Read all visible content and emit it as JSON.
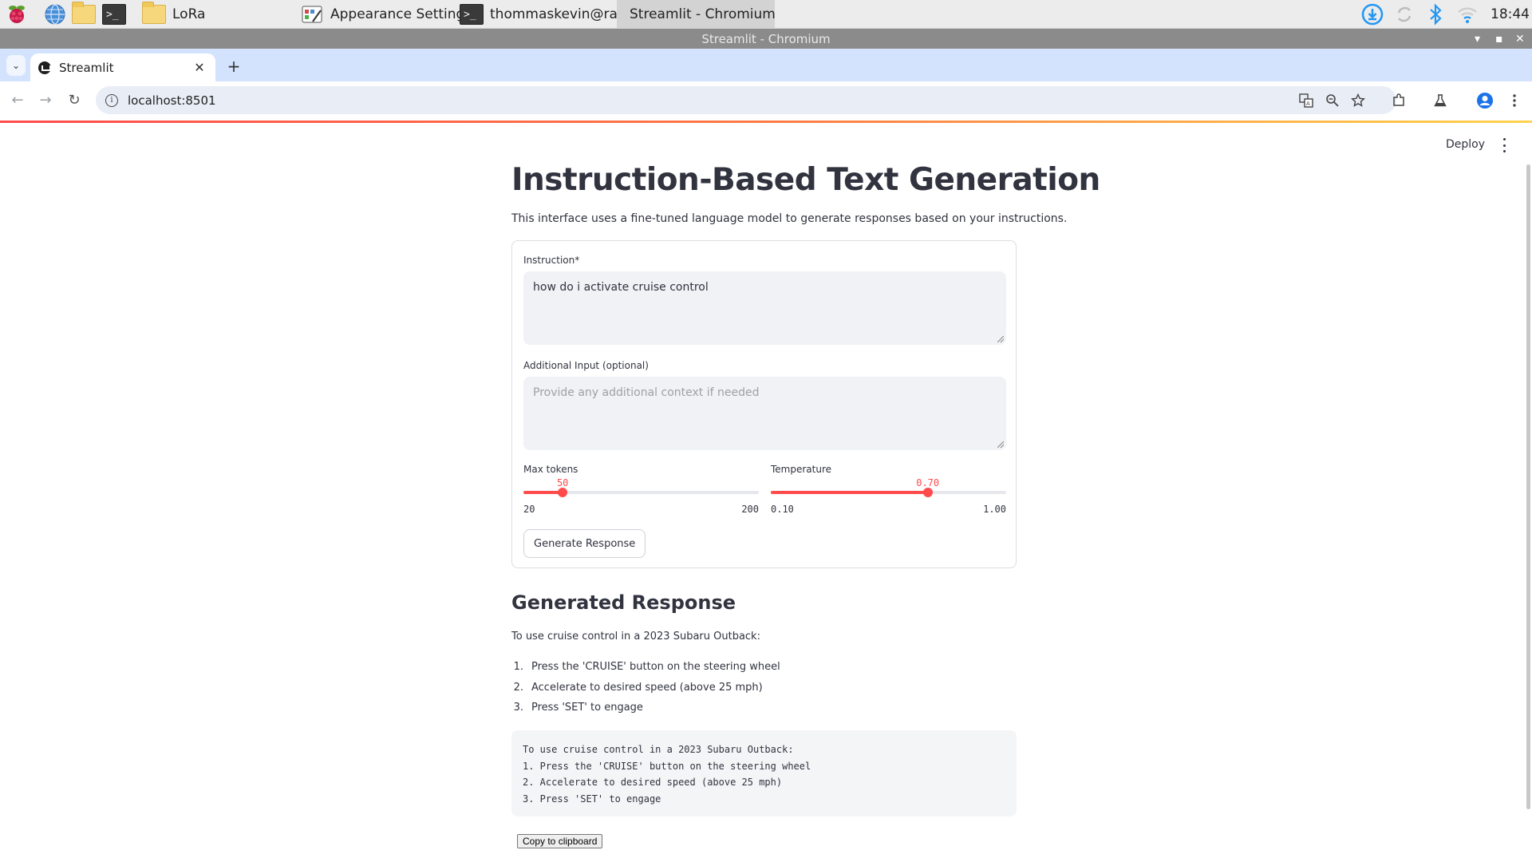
{
  "taskbar": {
    "tasks": [
      {
        "label": "LoRa",
        "icon": "folder-icon"
      },
      {
        "label": "Appearance Settings",
        "icon": "appearance-settings-icon"
      },
      {
        "label": "thommaskevin@ras..",
        "icon": "terminal-icon"
      },
      {
        "label": "Streamlit - Chromium",
        "icon": "chromium-icon"
      }
    ],
    "terminal_glyph": ">_",
    "clock": "18:44"
  },
  "window": {
    "title": "Streamlit - Chromium",
    "controls": {
      "minimize": "▾",
      "maximize": "▪",
      "close": "✕"
    }
  },
  "browser": {
    "tab_title": "Streamlit",
    "tab_close": "✕",
    "new_tab": "+",
    "tab_dropdown": "⌄",
    "url": "localhost:8501",
    "nav": {
      "back": "←",
      "forward": "→",
      "reload": "↻"
    }
  },
  "streamlit": {
    "deploy": "Deploy",
    "title": "Instruction-Based Text Generation",
    "description": "This interface uses a fine-tuned language model to generate responses based on your instructions.",
    "form": {
      "instruction_label": "Instruction*",
      "instruction_value": "how do i activate cruise control",
      "additional_label": "Additional Input (optional)",
      "additional_placeholder": "Provide any additional context if needed",
      "max_tokens": {
        "label": "Max tokens",
        "value": "50",
        "min": "20",
        "max": "200",
        "fraction": 0.1667
      },
      "temperature": {
        "label": "Temperature",
        "value": "0.70",
        "min": "0.10",
        "max": "1.00",
        "fraction": 0.6667
      },
      "generate_button": "Generate Response"
    },
    "response": {
      "heading": "Generated Response",
      "intro": "To use cruise control in a 2023 Subaru Outback:",
      "steps": [
        {
          "num": "1.",
          "text": "Press the 'CRUISE' button on the steering wheel"
        },
        {
          "num": "2.",
          "text": "Accelerate to desired speed (above 25 mph)"
        },
        {
          "num": "3.",
          "text": "Press 'SET' to engage"
        }
      ],
      "code_lines": [
        "To use cruise control in a 2023 Subaru Outback:",
        "1. Press the 'CRUISE' button on the steering wheel",
        "2. Accelerate to desired speed (above 25 mph)",
        "3. Press 'SET' to engage"
      ],
      "copy_button": "Copy to clipboard"
    }
  },
  "colors": {
    "accent": "#ff4b4b",
    "tabstrip": "#d3e3fd",
    "text": "#31333f"
  }
}
